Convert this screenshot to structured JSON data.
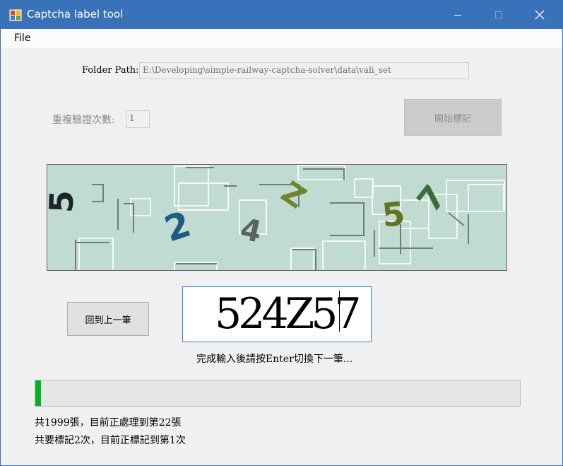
{
  "window": {
    "title": "Captcha label tool"
  },
  "menu": {
    "items": [
      "File"
    ]
  },
  "folder": {
    "label": "Folder Path:",
    "value": "E:\\Developing\\simple-railway-captcha-solver\\data\\vali_set"
  },
  "repeat": {
    "label": "重複驗證次數:",
    "value": "1"
  },
  "buttons": {
    "start": "開始標記",
    "back": "回到上一筆"
  },
  "captcha": {
    "characters": [
      "5",
      "2",
      "4",
      "Z",
      "5",
      "7"
    ]
  },
  "answer": {
    "value": "524Z57"
  },
  "hint": "完成輸入後請按Enter切換下一筆...",
  "progress": {
    "fraction": 0.011
  },
  "status": {
    "line1": "共1999張，目前正處理到第22張",
    "line2": "共要標記2次，目前正標記到第1次"
  },
  "colors": {
    "titlebar": "#3a72b9",
    "progress": "#06b025",
    "answer_border": "#2f7fd2"
  },
  "icons": [
    "app-icon",
    "minimize-icon",
    "maximize-icon",
    "close-icon"
  ]
}
